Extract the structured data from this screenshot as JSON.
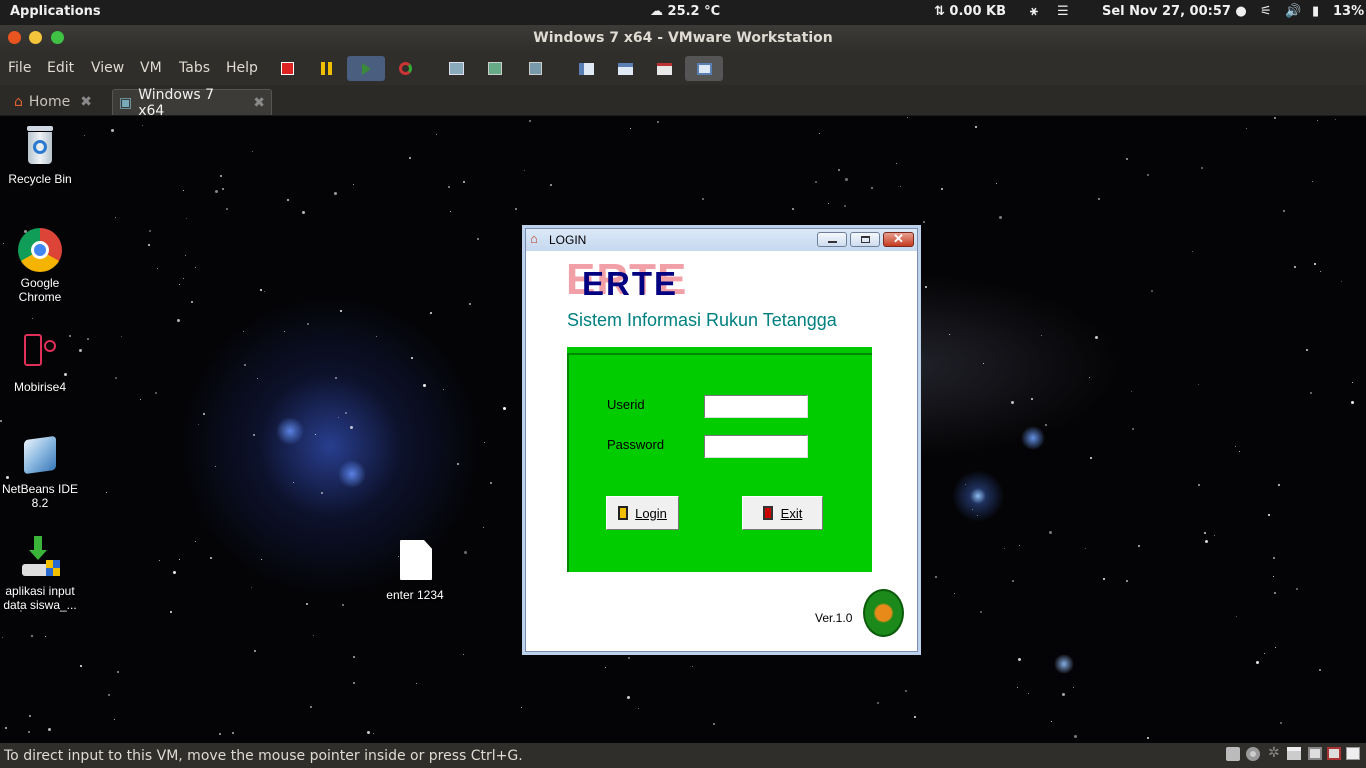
{
  "top_panel": {
    "applications": "Applications",
    "weather": "25.2 °C",
    "network": "⇅ 0.00 KB",
    "datetime": "Sel Nov 27, 00:57 ●",
    "battery": "13%"
  },
  "window": {
    "title": "Windows 7 x64 - VMware Workstation"
  },
  "menu": [
    "File",
    "Edit",
    "View",
    "VM",
    "Tabs",
    "Help"
  ],
  "tabs": [
    {
      "label": "Home",
      "active": false
    },
    {
      "label": "Windows 7 x64",
      "active": true
    }
  ],
  "desktop_icons": [
    {
      "label": "Recycle Bin"
    },
    {
      "label": "Google Chrome"
    },
    {
      "label": "Mobirise4"
    },
    {
      "label": "NetBeans IDE 8.2"
    },
    {
      "label": "aplikasi input data siswa_..."
    },
    {
      "label": "enter 1234"
    }
  ],
  "login": {
    "title": "LOGIN",
    "brand": "ERTE",
    "subtitle": "Sistem Informasi Rukun Tetangga",
    "userid_label": "Userid",
    "password_label": "Password",
    "userid_value": "",
    "password_value": "",
    "login_button": "Login",
    "exit_button": "Exit",
    "version": "Ver.1.0"
  },
  "statusbar": {
    "message": "To direct input to this VM, move the mouse pointer inside or press Ctrl+G."
  },
  "colors": {
    "panel_bg": "#1d1d1d",
    "login_green": "#00cc00",
    "brand_teal": "#008080",
    "brand_navy": "#000080"
  }
}
